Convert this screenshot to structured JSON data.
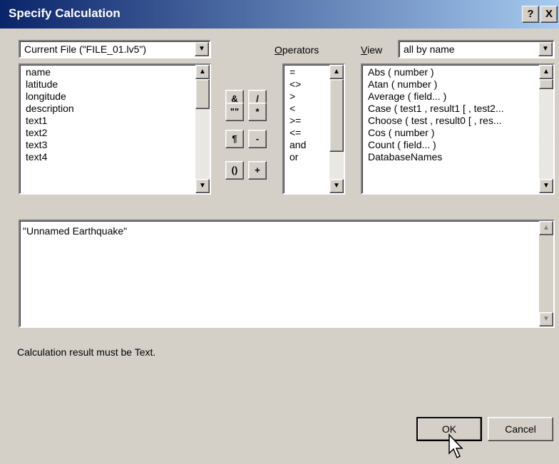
{
  "title": "Specify Calculation",
  "title_buttons": {
    "help": "?",
    "close": "X"
  },
  "file_combo": {
    "value": "Current File (\"FILE_01.lv5\")"
  },
  "fields": [
    "name",
    "latitude",
    "longitude",
    "description",
    "text1",
    "text2",
    "text3",
    "text4"
  ],
  "symbol_buttons": [
    "&",
    "/",
    "\"\"",
    "*",
    "¶",
    "-",
    "()",
    "+"
  ],
  "operators": {
    "label_prefix": "O",
    "label_rest": "perators",
    "items": [
      "=",
      "<>",
      ">",
      "<",
      ">=",
      "<=",
      "and",
      "or"
    ]
  },
  "view": {
    "label_prefix": "V",
    "label_rest": "iew",
    "value": "all by name",
    "items": [
      "Abs ( number )",
      "Atan ( number )",
      "Average ( field... )",
      "Case ( test1 , result1 [ , test2...",
      "Choose ( test , result0 [ , res...",
      "Cos ( number )",
      "Count ( field... )",
      "DatabaseNames"
    ]
  },
  "formula": "\"Unnamed Earthquake\"",
  "result_text": "Calculation result must be  Text.",
  "ok_label": "OK",
  "cancel_label": "Cancel",
  "icons": {
    "arrow_up": "▲",
    "arrow_down": "▼"
  }
}
